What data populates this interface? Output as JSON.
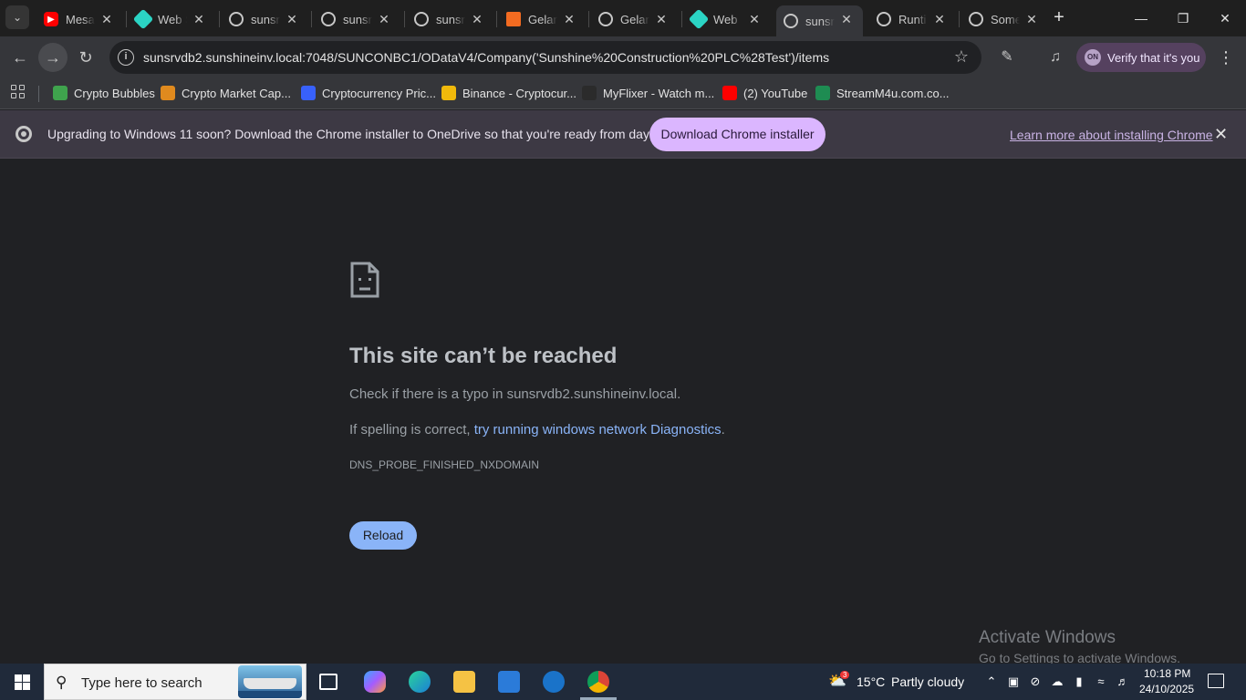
{
  "tabs": [
    {
      "title": "Mesa",
      "icon": "youtube-icon",
      "color": "#ff0000"
    },
    {
      "title": "Web S",
      "icon": "diamond-icon",
      "color": "#2bd4c4"
    },
    {
      "title": "sunsr",
      "icon": "globe-icon",
      "color": "#c7c7c7"
    },
    {
      "title": "sunsr",
      "icon": "globe-icon",
      "color": "#c7c7c7"
    },
    {
      "title": "sunsr",
      "icon": "globe-icon",
      "color": "#c7c7c7"
    },
    {
      "title": "Gelan",
      "icon": "gelan-icon",
      "color": "#f26b21"
    },
    {
      "title": "Gelan",
      "icon": "globe-icon",
      "color": "#c7c7c7"
    },
    {
      "title": "Web",
      "icon": "diamond-icon",
      "color": "#2bd4c4"
    },
    {
      "title": "sunsr",
      "icon": "globe-icon",
      "color": "#c7c7c7",
      "active": true
    },
    {
      "title": "Runti",
      "icon": "globe-icon",
      "color": "#c7c7c7"
    },
    {
      "title": "Some",
      "icon": "globe-icon",
      "color": "#c7c7c7"
    }
  ],
  "address_bar": {
    "url": "sunsrvdb2.sunshineinv.local:7048/SUNCONBC1/ODataV4/Company('Sunshine%20Construction%20PLC%28Test')/items"
  },
  "profile": {
    "label": "Verify that it's you",
    "avatar_text": "ON"
  },
  "bookmarks": [
    {
      "label": "Crypto Bubbles",
      "color": "#3fa34d"
    },
    {
      "label": "Crypto Market Cap...",
      "color": "#e08a1e"
    },
    {
      "label": "Cryptocurrency Pric...",
      "color": "#3861fb"
    },
    {
      "label": "Binance - Cryptocur...",
      "color": "#f0b90b"
    },
    {
      "label": "MyFlixer - Watch m...",
      "color": "#2b2b2b"
    },
    {
      "label": "(2) YouTube",
      "color": "#ff0000"
    },
    {
      "label": "StreamM4u.com.co...",
      "color": "#1e8c52"
    }
  ],
  "infobar": {
    "message": "Upgrading to Windows 11 soon? Download the Chrome installer to OneDrive so that you're ready from day one.",
    "button": "Download Chrome installer",
    "link": "Learn more about installing Chrome"
  },
  "error_page": {
    "title": "This site can’t be reached",
    "line1": "Check if there is a typo in sunsrvdb2.sunshineinv.local.",
    "line2_prefix": "If spelling is correct, ",
    "line2_link": "try running windows network Diagnostics",
    "line2_suffix": ".",
    "code": "DNS_PROBE_FINISHED_NXDOMAIN",
    "reload": "Reload"
  },
  "watermark": {
    "line1": "Activate Windows",
    "line2": "Go to Settings to activate Windows."
  },
  "taskbar": {
    "search_placeholder": "Type here to search",
    "weather_badge": "3",
    "temperature": "15°C",
    "weather": "Partly cloudy",
    "time": "10:18 PM",
    "date": "24/10/2025"
  }
}
